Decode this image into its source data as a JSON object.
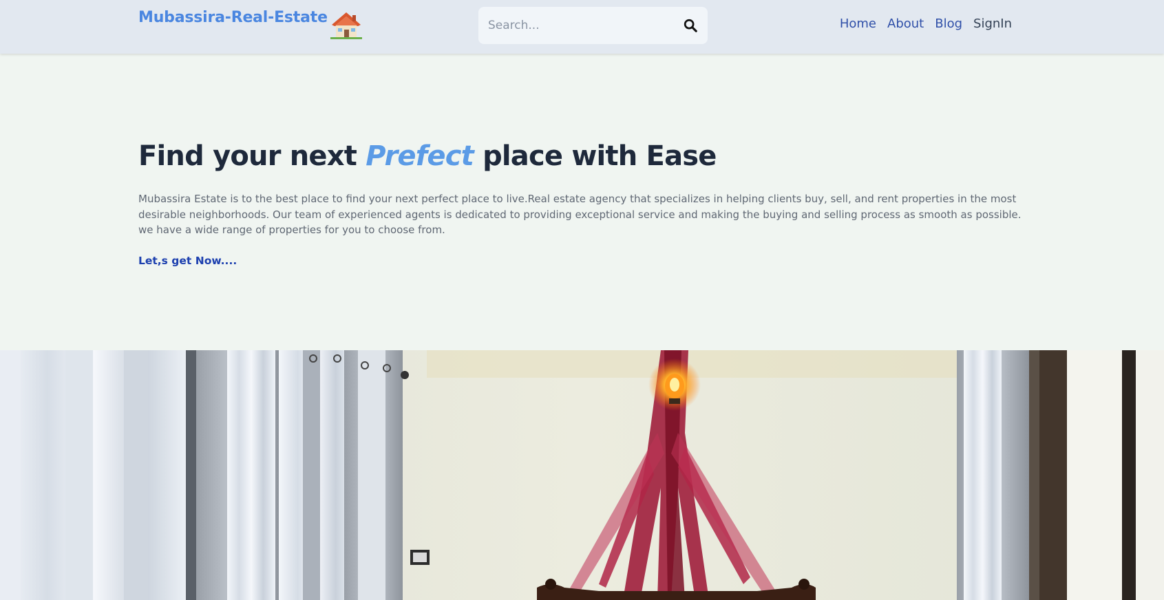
{
  "header": {
    "logo_text": "Mubassira-Real-Estate",
    "logo_icon": "house-with-garden-icon",
    "search": {
      "placeholder": "Search...",
      "value": "",
      "icon": "search-icon"
    },
    "nav": [
      {
        "label": "Home"
      },
      {
        "label": "About"
      },
      {
        "label": "Blog"
      },
      {
        "label": "SignIn"
      }
    ]
  },
  "hero": {
    "title_before": "Find your next ",
    "title_accent": "Prefect",
    "title_after": " place with Ease",
    "description_line1": "Mubassira Estate is to the best place to find your next perfect place to live.Real estate agency that specializes in helping clients buy, sell, and rent properties in the most desirable neighborhoods. Our team of experienced agents is dedicated to providing exceptional service and making the buying and selling process as smooth as possible.",
    "description_line2": "we have a wide range of properties for you to choose from.",
    "cta_label": "Let,s get Now...."
  },
  "colors": {
    "header_bg": "#e2e8f0",
    "page_bg": "#f0f5f1",
    "brand": "#4a86e0",
    "accent": "#5b9be6",
    "nav_link": "#2f4fa8",
    "cta": "#1d40af",
    "title": "#1e293b"
  }
}
